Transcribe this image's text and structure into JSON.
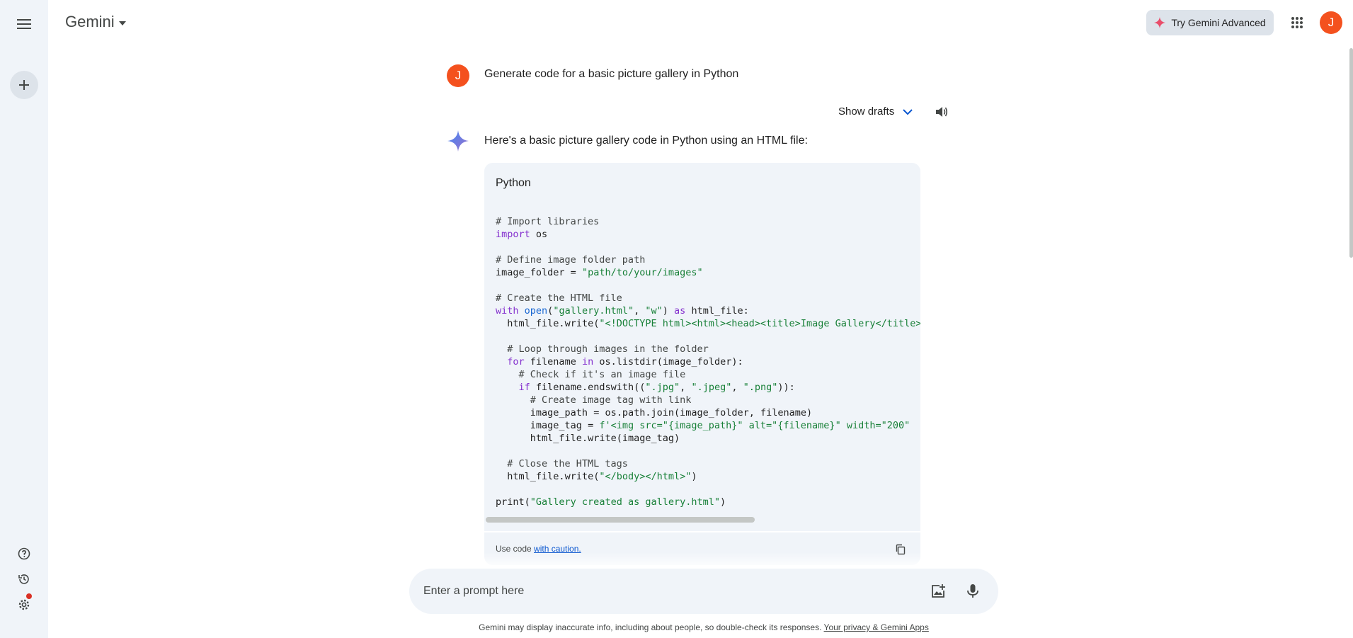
{
  "header": {
    "brand": "Gemini",
    "upgrade_label": "Try Gemini Advanced",
    "avatar_initial": "J"
  },
  "conversation": {
    "user_initial": "J",
    "user_prompt": "Generate code for a basic picture gallery in Python",
    "drafts_label": "Show drafts",
    "response_intro": "Here's a basic picture gallery code in Python using an HTML file:",
    "code_language": "Python",
    "code_lines": [
      "# Import libraries",
      "import os",
      "",
      "# Define image folder path",
      "image_folder = \"path/to/your/images\"",
      "",
      "# Create the HTML file",
      "with open(\"gallery.html\", \"w\") as html_file:",
      "  html_file.write(\"<!DOCTYPE html><html><head><title>Image Gallery</title>",
      "",
      "  # Loop through images in the folder",
      "  for filename in os.listdir(image_folder):",
      "    # Check if it's an image file",
      "    if filename.endswith((\".jpg\", \".jpeg\", \".png\")):",
      "      # Create image tag with link",
      "      image_path = os.path.join(image_folder, filename)",
      "      image_tag = f'<img src=\"{image_path}\" alt=\"{filename}\" width=\"200\"",
      "      html_file.write(image_tag)",
      "",
      "  # Close the HTML tags",
      "  html_file.write(\"</body></html>\")",
      "",
      "print(\"Gallery created as gallery.html\")"
    ],
    "caution_prefix": "Use code ",
    "caution_link": "with caution."
  },
  "prompt": {
    "placeholder": "Enter a prompt here"
  },
  "footer": {
    "disclaimer": "Gemini may display inaccurate info, including about people, so double-check its responses. ",
    "privacy_link": "Your privacy & Gemini Apps"
  },
  "colors": {
    "accent": "#0b57d0",
    "avatar": "#f4511e",
    "sidebar_bg": "#f0f4f9",
    "code_keyword": "#8430ce",
    "code_string": "#188038"
  },
  "icons": {
    "menu": "hamburger-menu-icon",
    "new_chat": "plus-icon",
    "help": "help-icon",
    "activity": "history-icon",
    "settings": "gear-icon",
    "apps": "grid-apps-icon",
    "upgrade": "sparkle-icon",
    "drafts": "chevron-down-icon",
    "speaker": "speaker-icon",
    "response": "gemini-sparkle-icon",
    "copy": "copy-icon",
    "image_upload": "add-image-icon",
    "mic": "microphone-icon"
  }
}
